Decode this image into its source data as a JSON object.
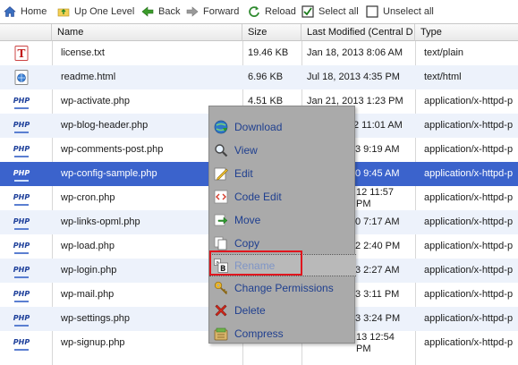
{
  "toolbar": {
    "home": "Home",
    "up": "Up One Level",
    "back": "Back",
    "forward": "Forward",
    "reload": "Reload",
    "select_all": "Select all",
    "unselect_all": "Unselect all"
  },
  "columns": {
    "name": "Name",
    "size": "Size",
    "modified": "Last Modified (Central D",
    "type": "Type"
  },
  "rows": [
    {
      "name": "license.txt",
      "size": "19.46 KB",
      "modified": "Jan 18, 2013 8:06 AM",
      "type": "text/plain",
      "icon": "text-file-icon"
    },
    {
      "name": "readme.html",
      "size": "6.96 KB",
      "modified": "Jul 18, 2013 4:35 PM",
      "type": "text/html",
      "icon": "html-file-icon"
    },
    {
      "name": "wp-activate.php",
      "size": "4.51 KB",
      "modified": "Jan 21, 2013 1:23 PM",
      "type": "application/x-httpd-p",
      "icon": "php-file-icon"
    },
    {
      "name": "wp-blog-header.php",
      "size": "",
      "modified": "2 11:01 AM",
      "type": "application/x-httpd-p",
      "icon": "php-file-icon"
    },
    {
      "name": "wp-comments-post.php",
      "size": "",
      "modified": "3 9:19 AM",
      "type": "application/x-httpd-p",
      "icon": "php-file-icon"
    },
    {
      "name": "wp-config-sample.php",
      "size": "",
      "modified": "0 9:45 AM",
      "type": "application/x-httpd-p",
      "icon": "php-file-icon"
    },
    {
      "name": "wp-cron.php",
      "size": "",
      "modified": "12 11:57",
      "type": "application/x-httpd-p",
      "icon": "php-file-icon"
    },
    {
      "name": "wp-links-opml.php",
      "size": "",
      "modified": "0 7:17 AM",
      "type": "application/x-httpd-p",
      "icon": "php-file-icon"
    },
    {
      "name": "wp-load.php",
      "size": "",
      "modified": "2 2:40 PM",
      "type": "application/x-httpd-p",
      "icon": "php-file-icon"
    },
    {
      "name": "wp-login.php",
      "size": "",
      "modified": "3 2:27 AM",
      "type": "application/x-httpd-p",
      "icon": "php-file-icon"
    },
    {
      "name": "wp-mail.php",
      "size": "",
      "modified": "3 3:11 PM",
      "type": "application/x-httpd-p",
      "icon": "php-file-icon"
    },
    {
      "name": "wp-settings.php",
      "size": "",
      "modified": "3 3:24 PM",
      "type": "application/x-httpd-p",
      "icon": "php-file-icon"
    },
    {
      "name": "wp-signup.php",
      "size": "",
      "modified": "13 12:54",
      "type": "application/x-httpd-p",
      "icon": "php-file-icon"
    }
  ],
  "row_extra_lines": {
    "wp-cron": "PM",
    "wp-signup": "PM"
  },
  "context_menu": [
    {
      "label": "Download",
      "icon": "download-icon"
    },
    {
      "label": "View",
      "icon": "view-icon"
    },
    {
      "label": "Edit",
      "icon": "edit-icon"
    },
    {
      "label": "Code Edit",
      "icon": "code-edit-icon"
    },
    {
      "label": "Move",
      "icon": "move-icon"
    },
    {
      "label": "Copy",
      "icon": "copy-icon"
    },
    {
      "label": "Rename",
      "icon": "rename-icon"
    },
    {
      "label": "Change Permissions",
      "icon": "key-icon"
    },
    {
      "label": "Delete",
      "icon": "delete-icon"
    },
    {
      "label": "Compress",
      "icon": "compress-icon"
    }
  ],
  "colors": {
    "selection": "#3b63cc",
    "alt_row": "#edf2fb",
    "menu_bg": "#aaaaaa",
    "menu_text": "#1f3f8f",
    "highlight_box": "#e0161e"
  }
}
